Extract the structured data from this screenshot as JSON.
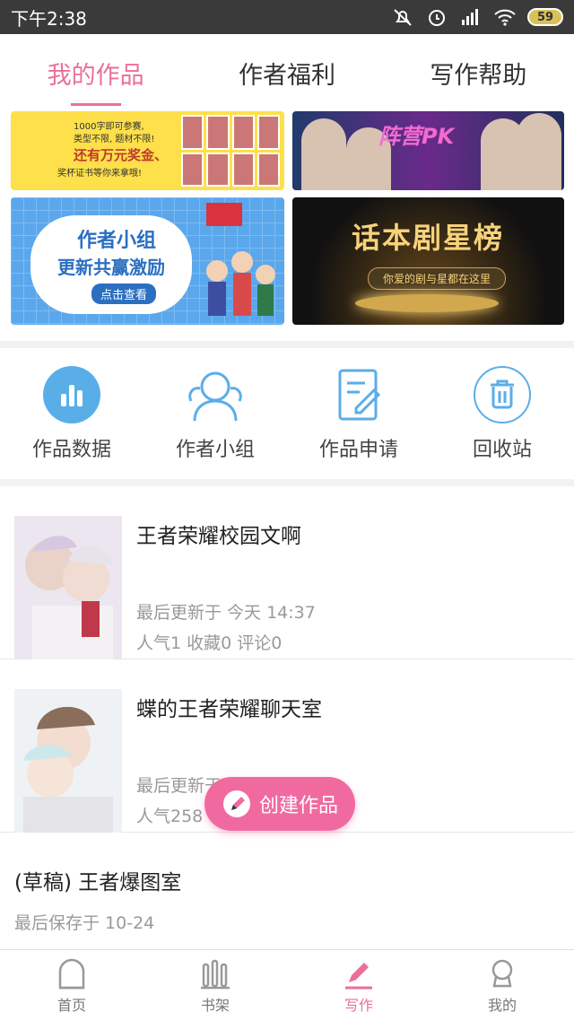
{
  "status_bar": {
    "time": "下午2:38",
    "battery": "59"
  },
  "tabs": [
    {
      "label": "我的作品",
      "active": true
    },
    {
      "label": "作者福利",
      "active": false
    },
    {
      "label": "写作帮助",
      "active": false
    }
  ],
  "banners": {
    "b1": {
      "line1": "1000字即可参赛,",
      "line2": "类型不限, 题材不限!",
      "line3": "还有万元奖金、",
      "line4": "奖杯证书等你来拿哦!"
    },
    "b2": {
      "title": "阵营PK"
    },
    "b3": {
      "title1": "作者小组",
      "title2": "更新共赢激励",
      "button": "点击查看"
    },
    "b4": {
      "title": "话本剧星榜",
      "subtitle": "你爱的剧与星都在这里"
    }
  },
  "quick_actions": [
    {
      "label": "作品数据",
      "icon": "bar-chart-icon"
    },
    {
      "label": "作者小组",
      "icon": "group-icon"
    },
    {
      "label": "作品申请",
      "icon": "document-edit-icon"
    },
    {
      "label": "回收站",
      "icon": "trash-icon"
    }
  ],
  "works": [
    {
      "title": "王者荣耀校园文啊",
      "updated": "最后更新于 今天 14:37",
      "stats": "人气1 收藏0 评论0"
    },
    {
      "title": "蝶的王者荣耀聊天室",
      "updated": "最后更新于 今天",
      "stats": "人气258"
    }
  ],
  "draft": {
    "title": "(草稿) 王者爆图室",
    "saved": "最后保存于 10-24"
  },
  "fab": {
    "label": "创建作品"
  },
  "bottom_nav": [
    {
      "label": "首页",
      "active": false
    },
    {
      "label": "书架",
      "active": false
    },
    {
      "label": "写作",
      "active": true
    },
    {
      "label": "我的",
      "active": false
    }
  ],
  "colors": {
    "accent": "#ea6f9a",
    "fab": "#f06aa0",
    "icon_blue": "#5aaee8"
  }
}
